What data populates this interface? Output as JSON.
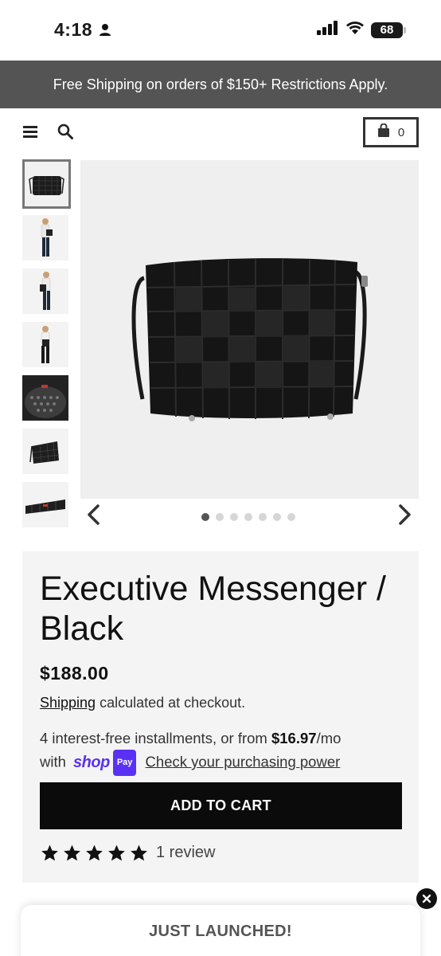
{
  "status_bar": {
    "time": "4:18",
    "battery": "68",
    "icons": [
      "person-icon",
      "signal-icon",
      "wifi-icon",
      "battery-icon"
    ]
  },
  "announcement": {
    "text": "Free Shipping on orders of $150+ Restrictions Apply."
  },
  "header": {
    "cart_count": "0",
    "icons": [
      "menu-icon",
      "search-icon",
      "cart-bag-icon"
    ]
  },
  "gallery": {
    "thumbnails": [
      "thumb-bag-front",
      "thumb-model-1",
      "thumb-model-2",
      "thumb-model-3",
      "thumb-interior",
      "thumb-bag-side",
      "thumb-bag-bottom"
    ],
    "dots_count": 7,
    "active_index": 0
  },
  "product": {
    "title": "Executive Messenger / Black",
    "price": "$188.00",
    "shipping_link": "Shipping",
    "shipping_text": " calculated at checkout.",
    "installments_prefix": "4 interest-free installments, or from ",
    "installments_amount": "$16.97",
    "installments_suffix": "/mo",
    "with_text": "with",
    "shop_word": "shop",
    "pay_badge": "Pay",
    "check_link": "Check your purchasing power",
    "add_to_cart": "ADD TO CART",
    "rating": 5,
    "review_count": "1 review"
  },
  "popup": {
    "title": "JUST LAUNCHED!"
  },
  "colors": {
    "announcement_bg": "#545454",
    "panel_bg": "#f4f4f4",
    "button_bg": "#0b0b0b",
    "shop_purple": "#5a31f4"
  }
}
